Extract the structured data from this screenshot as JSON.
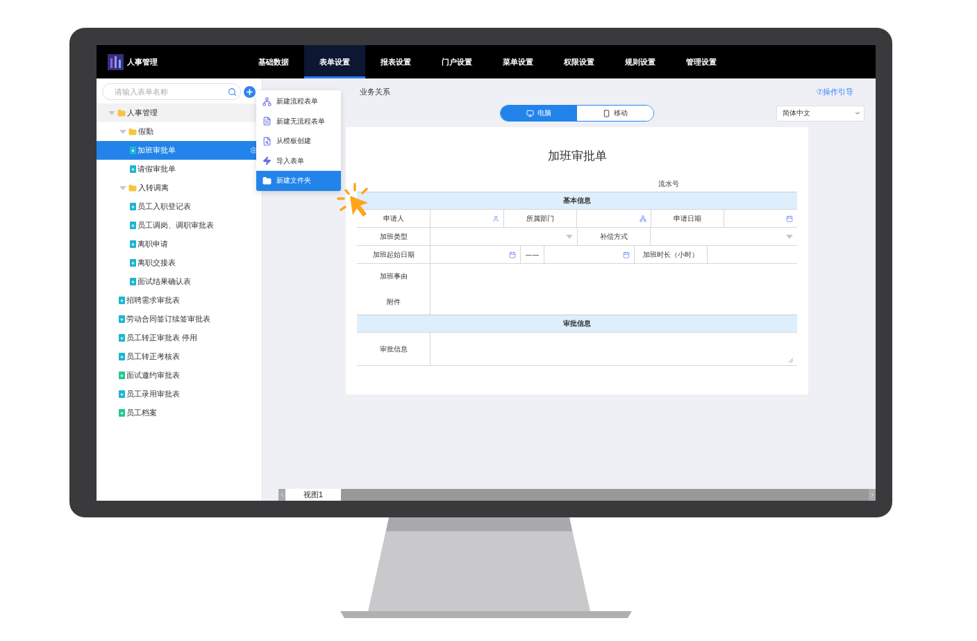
{
  "app": {
    "title": "人事管理"
  },
  "nav": [
    {
      "label": "基础数据",
      "selected": false
    },
    {
      "label": "表单设置",
      "selected": true
    },
    {
      "label": "报表设置",
      "selected": false
    },
    {
      "label": "门户设置",
      "selected": false
    },
    {
      "label": "菜单设置",
      "selected": false
    },
    {
      "label": "权限设置",
      "selected": false
    },
    {
      "label": "规则设置",
      "selected": false
    },
    {
      "label": "管理设置",
      "selected": false
    }
  ],
  "search": {
    "placeholder": "请输入表单名称"
  },
  "tree": [
    {
      "label": "人事管理",
      "kind": "folder",
      "expanded": true,
      "selected": false,
      "children": [
        {
          "label": "假勤",
          "kind": "folder",
          "expanded": true,
          "selected": false,
          "children": [
            {
              "label": "加班审批单",
              "kind": "form",
              "selected": true,
              "color": "#1fb5d1"
            },
            {
              "label": "请假审批单",
              "kind": "form",
              "selected": false,
              "color": "#1fb5d1"
            }
          ]
        },
        {
          "label": "入转调离",
          "kind": "folder",
          "expanded": true,
          "selected": false,
          "children": [
            {
              "label": "员工入职登记表",
              "kind": "form",
              "selected": false,
              "color": "#1fb5d1"
            },
            {
              "label": "员工调岗、调职审批表",
              "kind": "form",
              "selected": false,
              "color": "#1fb5d1"
            },
            {
              "label": "离职申请",
              "kind": "form",
              "selected": false,
              "color": "#1fb5d1"
            },
            {
              "label": "离职交接表",
              "kind": "form",
              "selected": false,
              "color": "#1fb5d1"
            },
            {
              "label": "面试结果确认表",
              "kind": "form",
              "selected": false,
              "color": "#1fb5d1"
            }
          ]
        },
        {
          "label": "招聘需求审批表",
          "kind": "form",
          "selected": false,
          "color": "#1fb5d1"
        },
        {
          "label": "劳动合同签订续签审批表",
          "kind": "form",
          "selected": false,
          "color": "#1fb5d1"
        },
        {
          "label": "员工转正审批表 停用",
          "kind": "form",
          "selected": false,
          "color": "#1fb5d1"
        },
        {
          "label": "员工转正考核表",
          "kind": "form",
          "selected": false,
          "color": "#1fb5d1"
        },
        {
          "label": "面试邀约审批表",
          "kind": "form",
          "selected": false,
          "color": "#22c98f"
        },
        {
          "label": "员工录用审批表",
          "kind": "form",
          "selected": false,
          "color": "#1fb5d1"
        },
        {
          "label": "员工档案",
          "kind": "form",
          "selected": false,
          "color": "#22c98f"
        }
      ]
    }
  ],
  "menu": [
    {
      "label": "新建流程表单",
      "kind": "flow",
      "selected": false
    },
    {
      "label": "新建无流程表单",
      "kind": "plain",
      "selected": false
    },
    {
      "label": "从模板创建",
      "kind": "template",
      "selected": false
    },
    {
      "label": "导入表单",
      "kind": "import",
      "selected": false
    },
    {
      "label": "新建文件夹",
      "kind": "folder",
      "selected": true
    }
  ],
  "tabs": [
    {
      "label": "业务关系"
    }
  ],
  "help_link": "⑦操作引导",
  "view_toggle": [
    {
      "label": "电脑",
      "kind": "desktop",
      "selected": true
    },
    {
      "label": "移动",
      "kind": "mobile",
      "selected": false
    }
  ],
  "language": "简体中文",
  "form": {
    "title": "加班审批单",
    "serial_label": "流水号",
    "sections": [
      {
        "title": "基本信息",
        "rows": [
          [
            {
              "kind": "label",
              "text": "申请人"
            },
            {
              "kind": "user"
            },
            {
              "kind": "label",
              "text": "所属部门"
            },
            {
              "kind": "dept"
            },
            {
              "kind": "label",
              "text": "申请日期"
            },
            {
              "kind": "date"
            }
          ],
          [
            {
              "kind": "label",
              "text": "加班类型"
            },
            {
              "kind": "select"
            },
            {
              "kind": "label",
              "text": "补偿方式"
            },
            {
              "kind": "select"
            }
          ],
          [
            {
              "kind": "label",
              "text": "加班起始日期"
            },
            {
              "kind": "date"
            },
            {
              "kind": "dash",
              "text": "——"
            },
            {
              "kind": "date"
            },
            {
              "kind": "label",
              "text": "加班时长（小时）"
            },
            {
              "kind": "text"
            }
          ],
          [
            {
              "kind": "stack",
              "texts": [
                "加班事由",
                "附件"
              ]
            },
            {
              "kind": "text"
            }
          ]
        ]
      },
      {
        "title": "审批信息",
        "rows": [
          [
            {
              "kind": "label",
              "text": "审批信息"
            },
            {
              "kind": "textarea"
            }
          ]
        ]
      }
    ]
  },
  "sheet_tabs": [
    {
      "label": "视图1",
      "selected": true
    }
  ]
}
